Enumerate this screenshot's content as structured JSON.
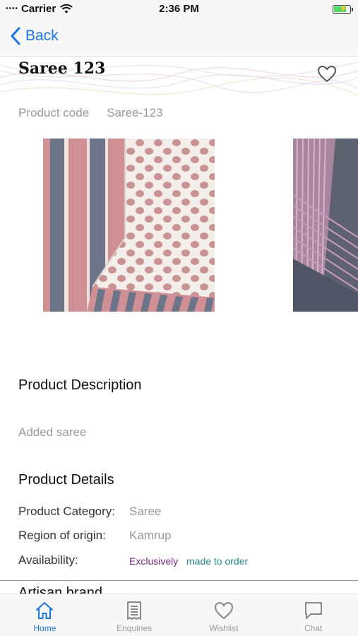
{
  "status_bar": {
    "carrier": "Carrier",
    "time": "2:36 PM",
    "battery_level": 0.8
  },
  "nav": {
    "back_label": "Back"
  },
  "product": {
    "title": "Saree 123",
    "code_label": "Product code",
    "code_value": "Saree-123"
  },
  "description": {
    "heading": "Product Description",
    "text": "Added saree"
  },
  "details": {
    "heading": "Product Details",
    "category_label": "Product Category:",
    "category_value": "Saree",
    "region_label": "Region of origin:",
    "region_value": "Kamrup",
    "availability_label": "Availability:",
    "availability_tag1": "Exclusively",
    "availability_tag2": "made to order"
  },
  "artisan": {
    "heading": "Artisan brand"
  },
  "tabs": [
    {
      "label": "Home",
      "icon": "home-icon",
      "active": true
    },
    {
      "label": "Enquiries",
      "icon": "enquiries-icon",
      "active": false
    },
    {
      "label": "Wishlist",
      "icon": "heart-icon",
      "active": false
    },
    {
      "label": "Chat",
      "icon": "chat-icon",
      "active": false
    }
  ],
  "colors": {
    "accent": "#1a73e8",
    "exclusive": "#7b2a8f",
    "made_to_order": "#2a8a8a",
    "muted": "#999999"
  }
}
